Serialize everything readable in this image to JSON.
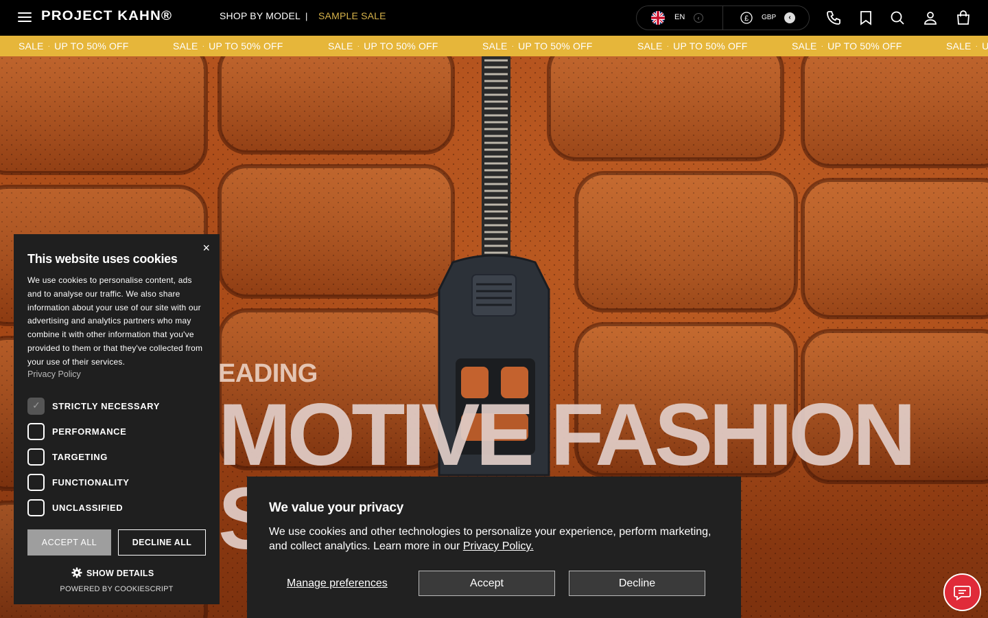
{
  "header": {
    "logo": "PROJECT KAHN®",
    "nav": {
      "shop_by_model": "SHOP BY MODEL",
      "separator": "|",
      "sample_sale": "SAMPLE SALE"
    },
    "language": "EN",
    "currency": "GBP",
    "icons": [
      "menu-icon",
      "phone-icon",
      "bookmark-icon",
      "search-icon",
      "account-icon",
      "bag-icon"
    ]
  },
  "marquee": {
    "items": [
      {
        "a": "SALE",
        "b": "UP TO 50% OFF"
      },
      {
        "a": "SALE",
        "b": "UP TO 50% OFF"
      },
      {
        "a": "SALE",
        "b": "UP TO 50% OFF"
      },
      {
        "a": "SALE",
        "b": "UP TO 50% OFF"
      },
      {
        "a": "SALE",
        "b": "UP TO 50% OFF"
      },
      {
        "a": "SALE",
        "b": "UP TO 50% OFF"
      },
      {
        "a": "SALE",
        "b": "U"
      }
    ],
    "dot": "·"
  },
  "hero": {
    "kicker": "EADING",
    "headline": "MOTIVE FASHION",
    "headline2": "SI"
  },
  "cookie_panel": {
    "title": "This website uses cookies",
    "body": "We use cookies to personalise content, ads and to analyse our traffic. We also share information about your use of our site with our advertising and analytics partners who may combine it with other information that you've provided to them or that they've collected from your use of their services.",
    "privacy_link": "Privacy Policy",
    "options": [
      {
        "label": "STRICTLY NECESSARY",
        "checked": true
      },
      {
        "label": "PERFORMANCE",
        "checked": false
      },
      {
        "label": "TARGETING",
        "checked": false
      },
      {
        "label": "FUNCTIONALITY",
        "checked": false
      },
      {
        "label": "UNCLASSIFIED",
        "checked": false
      }
    ],
    "accept_all": "ACCEPT ALL",
    "decline_all": "DECLINE ALL",
    "show_details": "SHOW DETAILS",
    "powered_by": "POWERED BY COOKIESCRIPT",
    "close": "×"
  },
  "privacy_banner": {
    "title": "We value your privacy",
    "text": "We use cookies and other technologies to personalize your experience, perform marketing, and collect analytics. Learn more in our ",
    "link": "Privacy Policy.",
    "manage": "Manage preferences",
    "accept": "Accept",
    "decline": "Decline"
  },
  "colors": {
    "sale_accent": "#d6b24a",
    "marquee_bg": "#e6b63a",
    "chat_red": "#e02b39"
  }
}
